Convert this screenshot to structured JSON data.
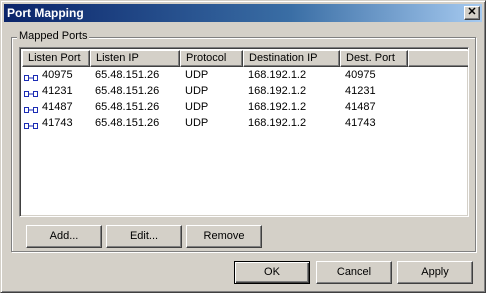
{
  "window": {
    "title": "Port Mapping",
    "close_glyph": "✕"
  },
  "group": {
    "label": "Mapped Ports"
  },
  "list": {
    "columns": [
      "Listen Port",
      "Listen IP",
      "Protocol",
      "Destination IP",
      "Dest. Port",
      ""
    ],
    "rows": [
      {
        "listen_port": "40975",
        "listen_ip": "65.48.151.26",
        "protocol": "UDP",
        "destination_ip": "168.192.1.2",
        "dest_port": "40975",
        "icon": "port-icon"
      },
      {
        "listen_port": "41231",
        "listen_ip": "65.48.151.26",
        "protocol": "UDP",
        "destination_ip": "168.192.1.2",
        "dest_port": "41231",
        "icon": "port-icon"
      },
      {
        "listen_port": "41487",
        "listen_ip": "65.48.151.26",
        "protocol": "UDP",
        "destination_ip": "168.192.1.2",
        "dest_port": "41487",
        "icon": "port-icon"
      },
      {
        "listen_port": "41743",
        "listen_ip": "65.48.151.26",
        "protocol": "UDP",
        "destination_ip": "168.192.1.2",
        "dest_port": "41743",
        "icon": "port-icon"
      }
    ]
  },
  "group_buttons": {
    "add": "Add...",
    "edit": "Edit...",
    "remove": "Remove"
  },
  "dialog_buttons": {
    "ok": "OK",
    "cancel": "Cancel",
    "apply": "Apply"
  },
  "colors": {
    "title_start": "#0a246a",
    "title_end": "#a6caf0",
    "face": "#d4d0c8",
    "icon_blue": "#1c2db5"
  }
}
